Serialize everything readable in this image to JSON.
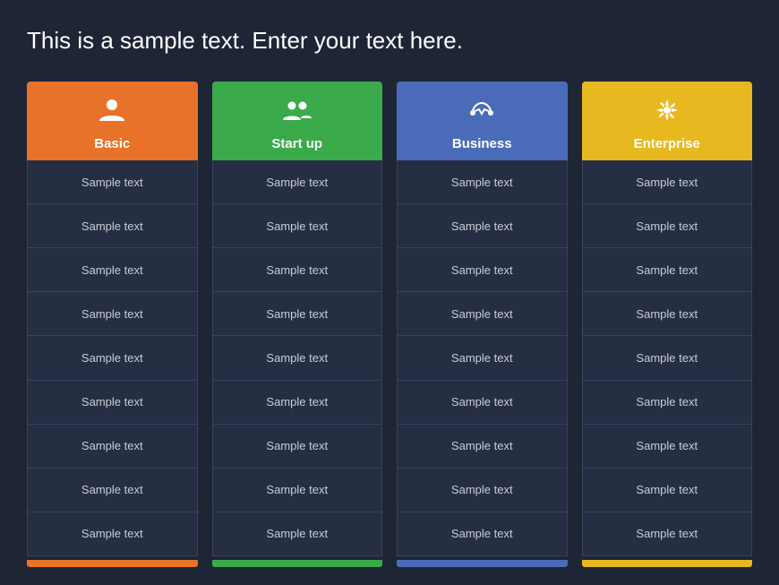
{
  "headline": "This is a sample text. Enter your text here.",
  "columns": [
    {
      "id": "basic",
      "title": "Basic",
      "icon": "👤",
      "icon_unicode": "&#128100;",
      "color": "#e8722a",
      "rows": [
        "Sample text",
        "Sample text",
        "Sample text",
        "Sample text",
        "Sample text",
        "Sample text",
        "Sample text",
        "Sample text",
        "Sample text"
      ]
    },
    {
      "id": "startup",
      "title": "Start up",
      "icon": "👥",
      "icon_unicode": "&#128101;",
      "color": "#3aaa4a",
      "rows": [
        "Sample text",
        "Sample text",
        "Sample text",
        "Sample text",
        "Sample text",
        "Sample text",
        "Sample text",
        "Sample text",
        "Sample text"
      ]
    },
    {
      "id": "business",
      "title": "Business",
      "icon": "🤝",
      "icon_unicode": "&#129309;",
      "color": "#4a6cb8",
      "rows": [
        "Sample text",
        "Sample text",
        "Sample text",
        "Sample text",
        "Sample text",
        "Sample text",
        "Sample text",
        "Sample text",
        "Sample text"
      ]
    },
    {
      "id": "enterprise",
      "title": "Enterprise",
      "icon": "⚙️",
      "icon_unicode": "&#9881;",
      "color": "#e8b820",
      "rows": [
        "Sample text",
        "Sample text",
        "Sample text",
        "Sample text",
        "Sample text",
        "Sample text",
        "Sample text",
        "Sample text",
        "Sample text"
      ]
    }
  ]
}
